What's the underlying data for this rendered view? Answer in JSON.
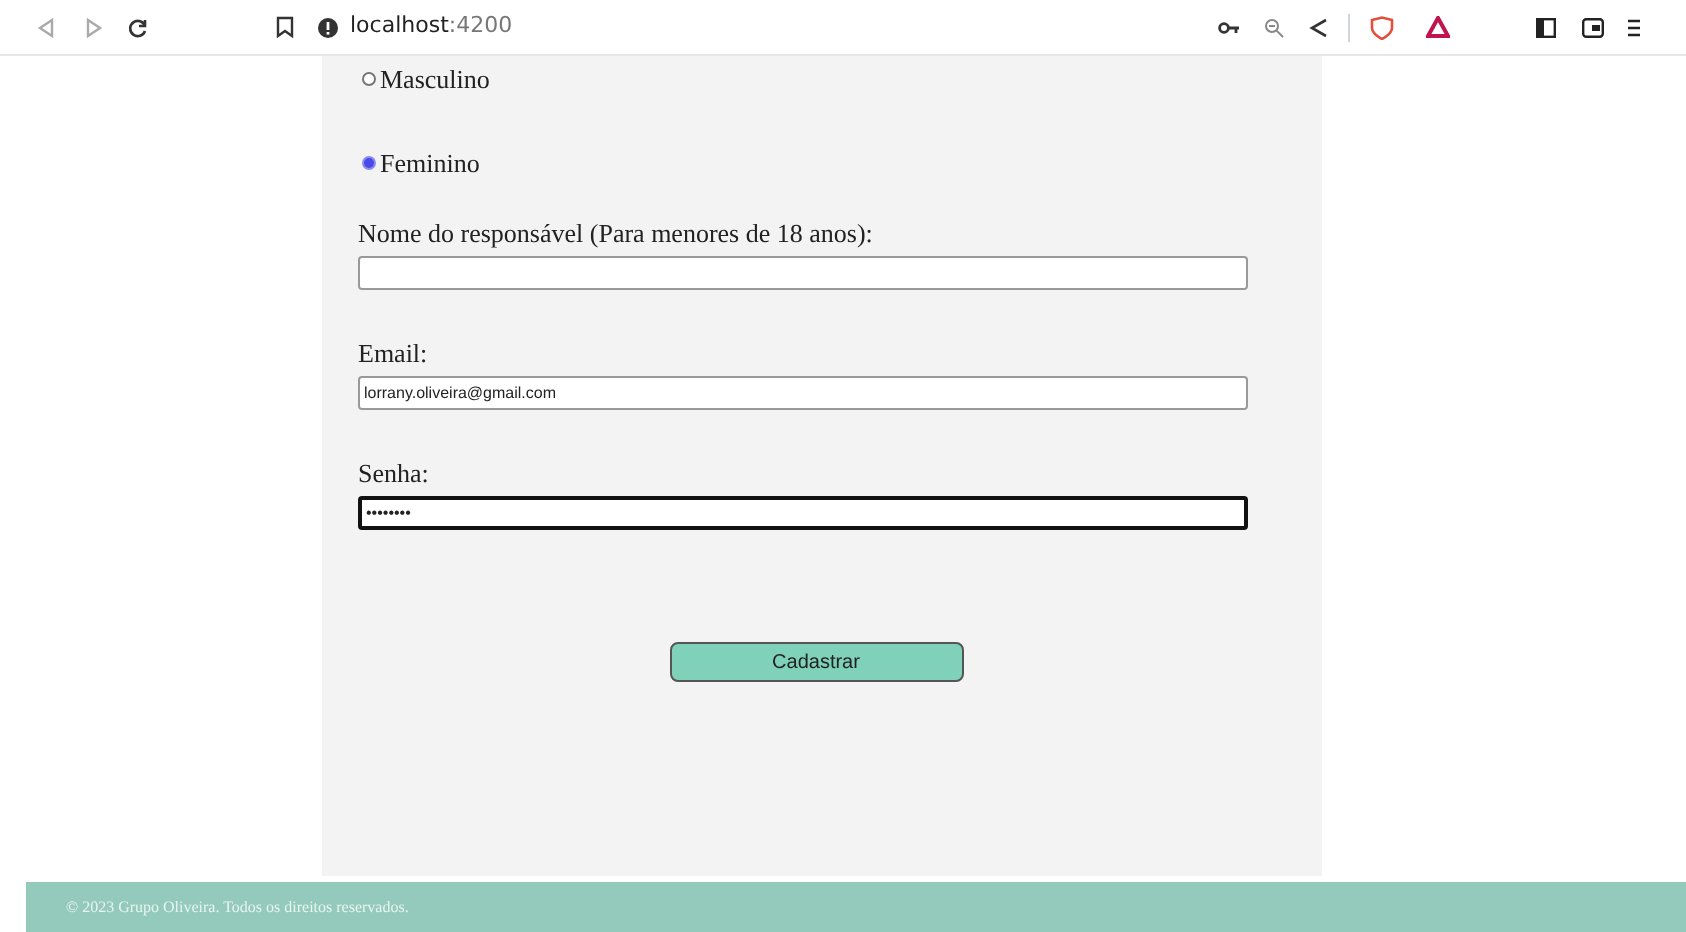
{
  "browser": {
    "url_host": "localhost",
    "url_port": ":4200"
  },
  "gender_options": [
    {
      "label": "Masculino",
      "selected": false
    },
    {
      "label": "Feminino",
      "selected": true
    }
  ],
  "fields": [
    {
      "label": "Nome do responsável (Para menores de 18 anos):",
      "focused": false
    },
    {
      "label": "Email:",
      "value": "lorrany.oliveira@gmail.com",
      "focused": false
    },
    {
      "label": "Senha:",
      "value": "••••••••",
      "focused": true
    }
  ],
  "submit_button": "Cadastrar",
  "footer": "© 2023 Grupo Oliveira. Todos os direitos reservados."
}
